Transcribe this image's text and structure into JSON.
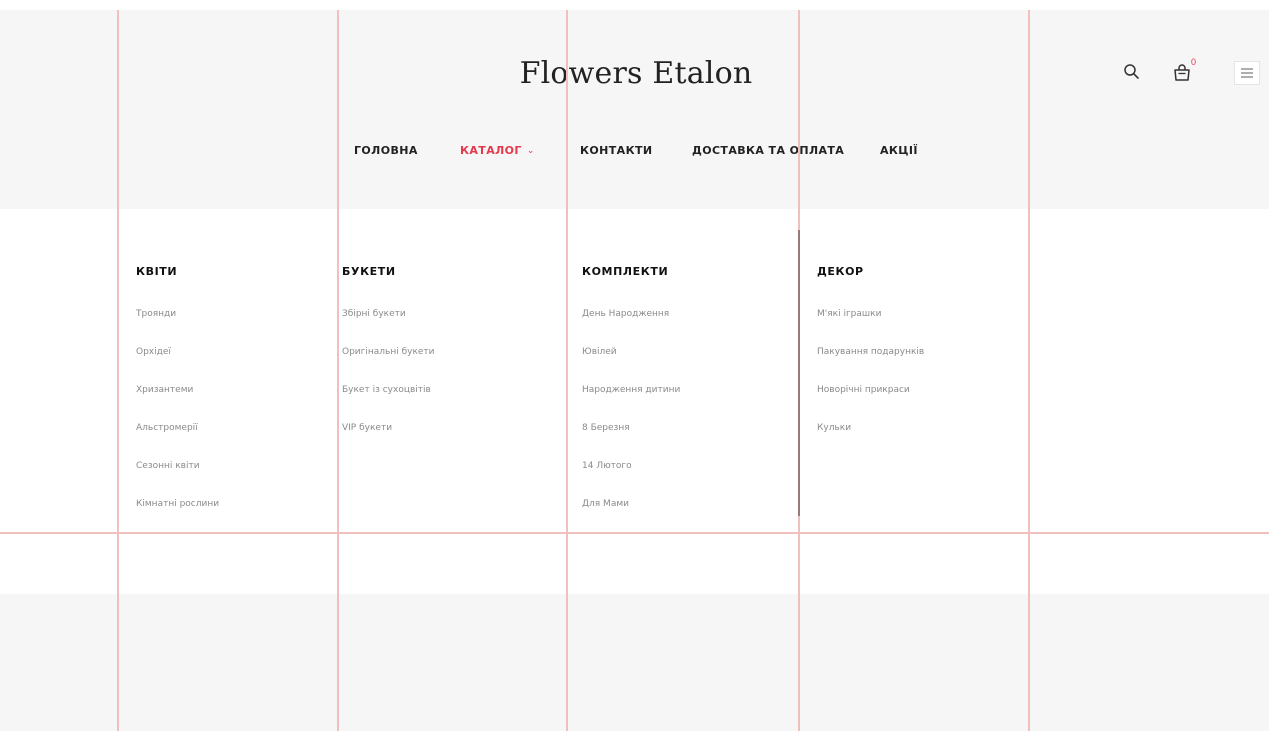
{
  "header": {
    "logo": "Flowers Etalon",
    "cart_count": "0",
    "icons": {
      "search": "search-icon",
      "cart": "shopping-bag-icon",
      "menu": "hamburger-menu-icon"
    }
  },
  "nav": {
    "items": [
      {
        "label": "ГОЛОВНА"
      },
      {
        "label": "КАТАЛОГ",
        "chevron": "⌄"
      },
      {
        "label": "КОНТАКТИ"
      },
      {
        "label": "ДОСТАВКА ТА ОПЛАТА"
      },
      {
        "label": "АКЦІЇ"
      }
    ]
  },
  "colors": {
    "accent": "#e23a4c",
    "guide_line": "#efc0bc",
    "band_bg": "#f6f6f6"
  },
  "menu": {
    "columns": [
      {
        "title": "КВІТИ",
        "items": [
          "Троянди",
          "Орхідеї",
          "Хризантеми",
          "Альстромерії",
          "Сезонні квіти",
          "Кімнатні рослини"
        ]
      },
      {
        "title": "БУКЕТИ",
        "items": [
          "Збірні букети",
          "Оригінальні букети",
          "Букет із сухоцвітів",
          "VIP букети"
        ]
      },
      {
        "title": "КОМПЛЕКТИ",
        "items": [
          "День Народження",
          "Ювілей",
          "Народження дитини",
          "8 Березня",
          "14 Лютого",
          "Для Мами"
        ]
      },
      {
        "title": "ДЕКОР",
        "items": [
          "М'які іграшки",
          "Пакування подарунків",
          "Новорічні прикраси",
          "Кульки"
        ]
      }
    ]
  }
}
